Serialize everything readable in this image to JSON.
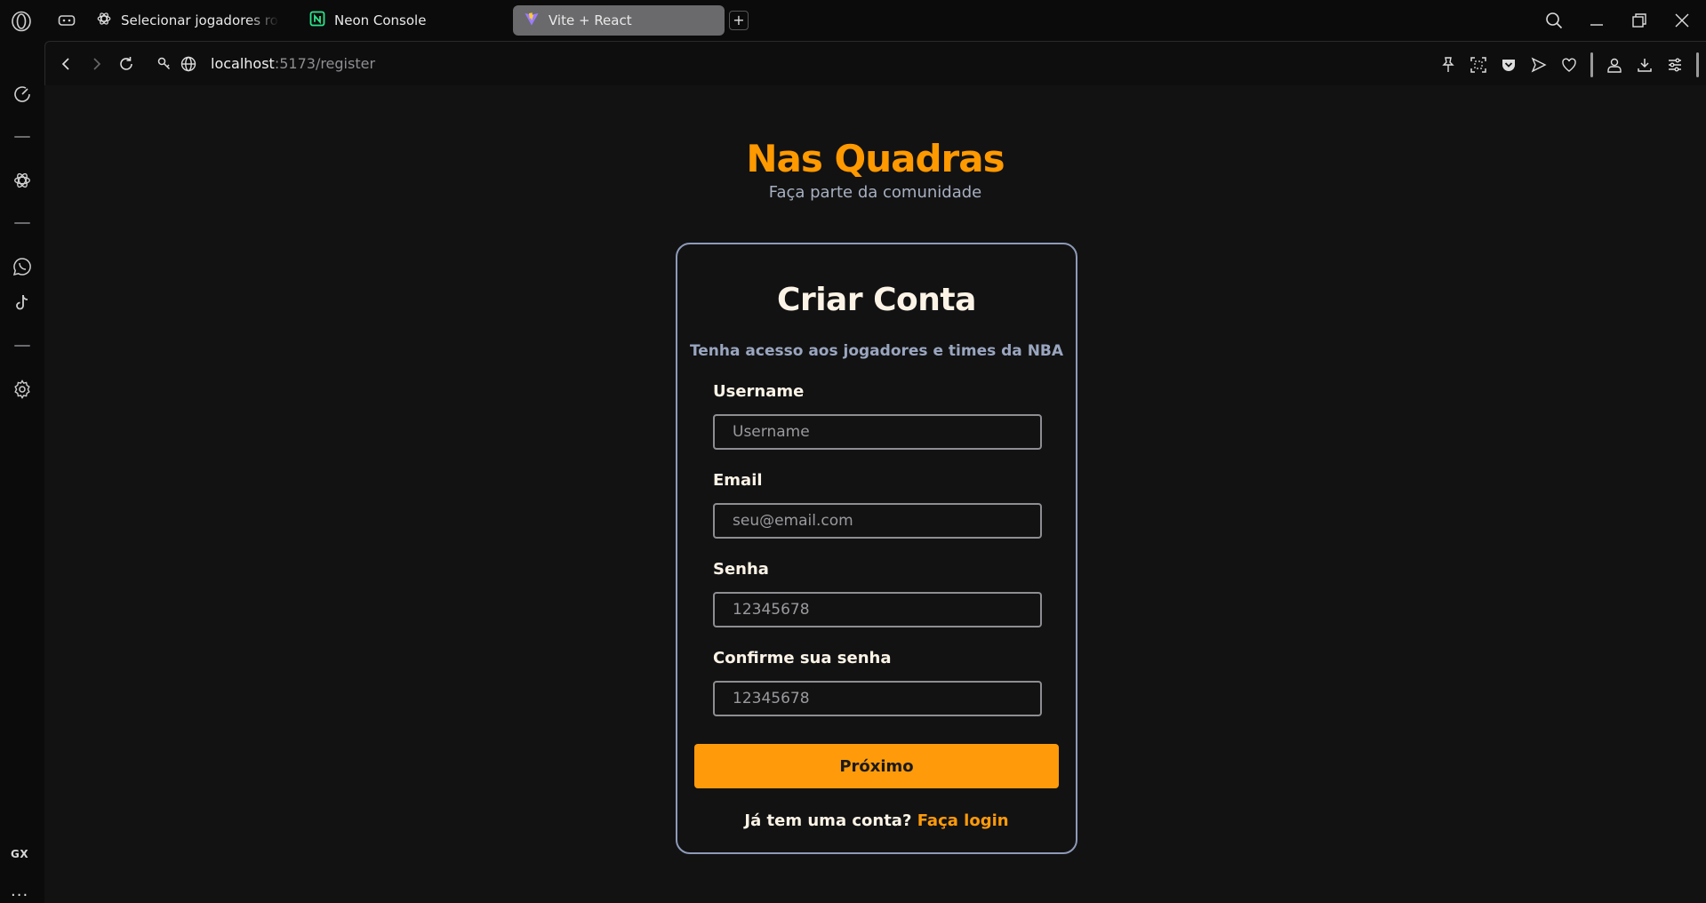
{
  "browser": {
    "tabs": [
      {
        "label": "Selecionar jogadores roste",
        "icon": "openai-icon"
      },
      {
        "label": "Neon Console",
        "icon": "neon-icon"
      },
      {
        "label": "Vite + React",
        "icon": "vite-icon",
        "active": true
      }
    ],
    "url": {
      "host": "localhost",
      "path": ":5173/register"
    }
  },
  "sidebar": {
    "gx_label": "GX",
    "more_label": "..."
  },
  "page": {
    "brand": "Nas Quadras",
    "brand_subtitle": "Faça parte da comunidade",
    "card": {
      "title": "Criar Conta",
      "subtitle": "Tenha acesso aos jogadores e times da NBA",
      "fields": [
        {
          "label": "Username",
          "placeholder": "Username"
        },
        {
          "label": "Email",
          "placeholder": "seu@email.com"
        },
        {
          "label": "Senha",
          "placeholder": "12345678"
        },
        {
          "label": "Confirme sua senha",
          "placeholder": "12345678"
        }
      ],
      "submit_label": "Próximo",
      "login_prompt": "Já tem uma conta?",
      "login_link": "Faça login"
    }
  },
  "colors": {
    "accent": "#ff9b0a",
    "background": "#121213",
    "card_border": "#8e9ab8"
  }
}
